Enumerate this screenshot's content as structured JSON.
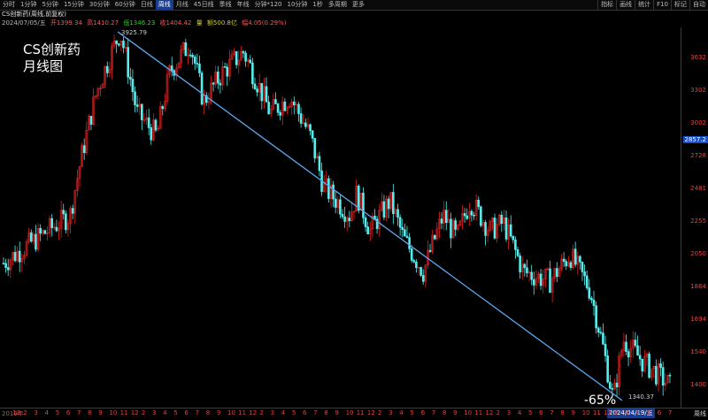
{
  "toolbar": {
    "items": [
      "分时",
      "1分钟",
      "5分钟",
      "15分钟",
      "30分钟",
      "60分钟",
      "日线",
      "周线",
      "月线",
      "45日线",
      "季线",
      "年线",
      "分钟*120",
      "10分钟",
      "1秒",
      "多周期",
      "更多"
    ],
    "active": 7,
    "right_items": [
      "指标",
      "画线",
      "统计",
      "F10",
      "标记",
      "自动"
    ]
  },
  "header": {
    "title": "CS创新药(周线,前复权)",
    "date": "2024/07/05/五",
    "open": "开1399.34",
    "high": "高1410.27",
    "low": "低1346.23",
    "close": "收1404.42",
    "volume": "量",
    "amount": "额500.8亿",
    "change": "幅4.05(0.29%)"
  },
  "overlay": {
    "line1": "CS创新药",
    "line2": "月线图",
    "pct": "-65%",
    "peak_label": "3925.79",
    "trough_label": "1340.37"
  },
  "y_axis": {
    "labels": [
      "3632",
      "3302",
      "3002",
      "2728",
      "2481",
      "2255",
      "2050",
      "1864",
      "1694",
      "1540",
      "1400"
    ],
    "current": "2857.2"
  },
  "x_axis": {
    "labels": [
      "2019年",
      "12",
      "2",
      "3",
      "4",
      "5",
      "6",
      "7",
      "8",
      "9",
      "10",
      "11",
      "12",
      "2",
      "3",
      "4",
      "5",
      "6",
      "7",
      "8",
      "9",
      "10",
      "11",
      "12",
      "2",
      "3",
      "4",
      "5",
      "6",
      "7",
      "8",
      "9",
      "10",
      "11",
      "12",
      "2",
      "3",
      "4",
      "5",
      "6",
      "7",
      "8",
      "9",
      "10",
      "11",
      "12",
      "2",
      "3",
      "4",
      "5",
      "6",
      "7",
      "8",
      "9",
      "10",
      "11",
      "12",
      "2",
      "3",
      "4",
      "5",
      "6",
      "7"
    ],
    "selected_date": "2024/04/19/五",
    "period": "周线"
  },
  "chart_data": {
    "type": "candlestick",
    "series_hint": "weekly candles, log-scale y",
    "ylim": [
      1340,
      3925
    ],
    "trendline": {
      "from": 3925.79,
      "to": 1340.37,
      "change": "-65%"
    },
    "colors": {
      "up": "#e02020",
      "down": "#55eeee",
      "line": "#5aa9f0"
    }
  }
}
